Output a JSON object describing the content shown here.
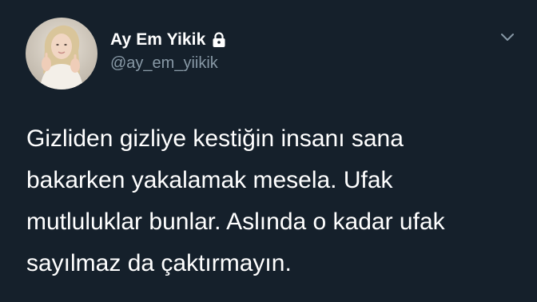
{
  "author": {
    "display_name": "Ay Em Yikik",
    "handle": "@ay_em_yiikik",
    "protected_icon": "lock-icon",
    "avatar_icon": "profile-photo"
  },
  "menu": {
    "icon": "chevron-down-icon"
  },
  "tweet": {
    "text": "Gizliden gizliye kestiğin insanı sana\nbakarken yakalamak mesela. Ufak\nmutluluklar bunlar. Aslında o kadar ufak\nsayılmaz da çaktırmayın."
  },
  "colors": {
    "background": "#15202b",
    "text_primary": "#ffffff",
    "text_secondary": "#8899a6"
  }
}
